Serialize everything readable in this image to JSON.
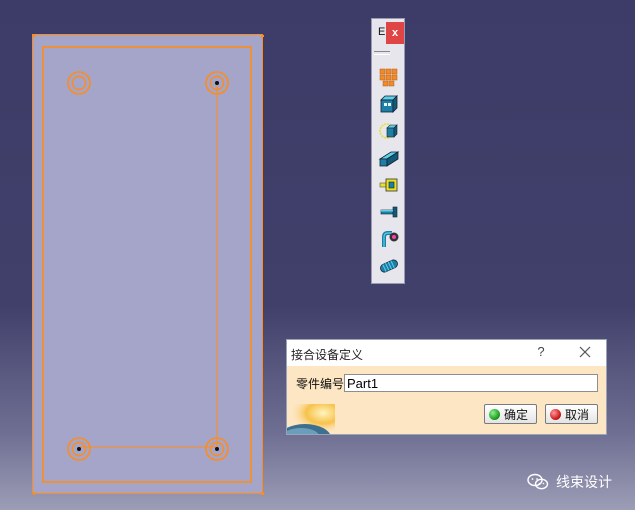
{
  "toolbar": {
    "title_abbrev": "E",
    "close_label": "x",
    "tools": [
      "bundle-segment-icon",
      "connector-icon",
      "shell-icon",
      "protective-covering-icon",
      "support-icon",
      "pin-icon",
      "bent-support-icon",
      "corrugated-tube-icon"
    ]
  },
  "dialog": {
    "title": "接合设备定义",
    "help_label": "?",
    "field_label": "零件编号",
    "part_number_value": "Part1",
    "ok_label": "确定",
    "cancel_label": "取消"
  },
  "watermark": {
    "text": "线束设计",
    "icon": "wechat-icon"
  },
  "colors": {
    "part_face": "#a4a5c8",
    "part_edge": "#ff8c1a",
    "dialog_body": "#fde6c3",
    "ok_dot": "#22a322",
    "cancel_dot": "#d22020"
  }
}
